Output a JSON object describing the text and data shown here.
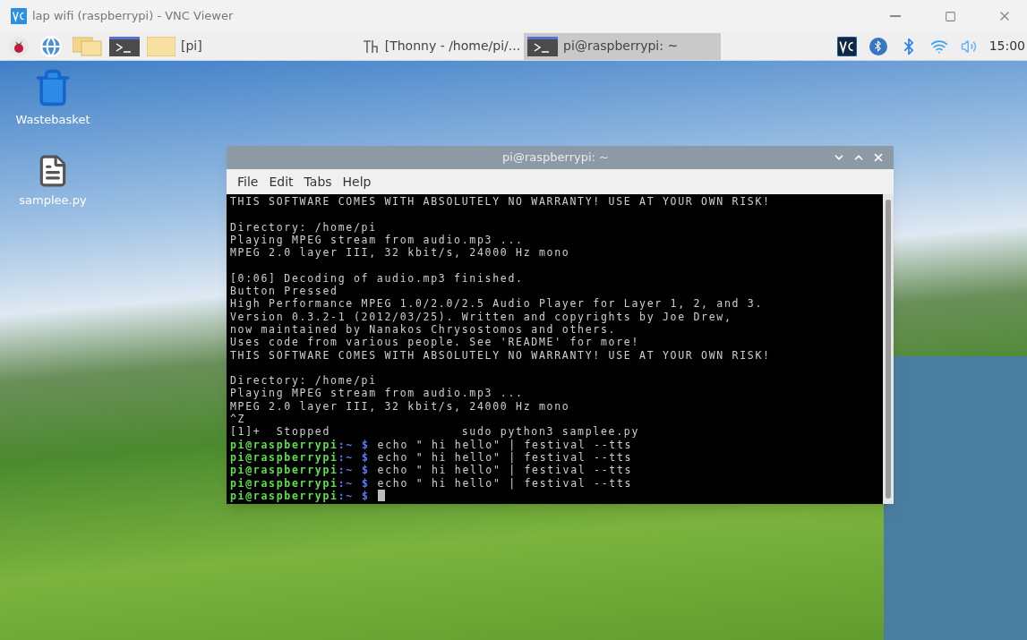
{
  "window": {
    "title": "lap wifi (raspberrypi) - VNC Viewer"
  },
  "taskbar": {
    "launchers": [
      {
        "kind": "raspberry"
      },
      {
        "kind": "globe"
      },
      {
        "kind": "folders"
      },
      {
        "kind": "terminal"
      }
    ],
    "tasks": [
      {
        "kind": "folder",
        "label": "[pi]",
        "selected": false
      },
      {
        "kind": "thonny",
        "label": "[Thonny  -  /home/pi/...",
        "selected": false
      },
      {
        "kind": "terminal",
        "label": "pi@raspberrypi: ~",
        "selected": true
      }
    ],
    "clock": "15:00"
  },
  "desktop_icons": [
    {
      "kind": "trash",
      "label": "Wastebasket"
    },
    {
      "kind": "file",
      "label": "samplee.py"
    }
  ],
  "terminal": {
    "title": "pi@raspberrypi: ~",
    "menu": [
      "File",
      "Edit",
      "Tabs",
      "Help"
    ],
    "lines": [
      {
        "kind": "output",
        "text": "THIS SOFTWARE COMES WITH ABSOLUTELY NO WARRANTY! USE AT YOUR OWN RISK!"
      },
      {
        "kind": "blank"
      },
      {
        "kind": "output",
        "text": "Directory: /home/pi"
      },
      {
        "kind": "output",
        "text": "Playing MPEG stream from audio.mp3 ..."
      },
      {
        "kind": "output",
        "text": "MPEG 2.0 layer III, 32 kbit/s, 24000 Hz mono"
      },
      {
        "kind": "blank"
      },
      {
        "kind": "output",
        "text": "[0:06] Decoding of audio.mp3 finished."
      },
      {
        "kind": "output",
        "text": "Button Pressed"
      },
      {
        "kind": "output",
        "text": "High Performance MPEG 1.0/2.0/2.5 Audio Player for Layer 1, 2, and 3."
      },
      {
        "kind": "output",
        "text": "Version 0.3.2-1 (2012/03/25). Written and copyrights by Joe Drew,"
      },
      {
        "kind": "output",
        "text": "now maintained by Nanakos Chrysostomos and others."
      },
      {
        "kind": "output",
        "text": "Uses code from various people. See 'README' for more!"
      },
      {
        "kind": "output",
        "text": "THIS SOFTWARE COMES WITH ABSOLUTELY NO WARRANTY! USE AT YOUR OWN RISK!"
      },
      {
        "kind": "blank"
      },
      {
        "kind": "output",
        "text": "Directory: /home/pi"
      },
      {
        "kind": "output",
        "text": "Playing MPEG stream from audio.mp3 ..."
      },
      {
        "kind": "output",
        "text": "MPEG 2.0 layer III, 32 kbit/s, 24000 Hz mono"
      },
      {
        "kind": "output",
        "text": "^Z"
      },
      {
        "kind": "output",
        "text": "[1]+  Stopped                 sudo python3 samplee.py"
      },
      {
        "kind": "prompt",
        "user": "pi@raspberrypi",
        "path": ":~",
        "symbol": "$",
        "command": "echo \" hi hello\" | festival --tts",
        "cursor": false
      },
      {
        "kind": "prompt",
        "user": "pi@raspberrypi",
        "path": ":~",
        "symbol": "$",
        "command": "echo \" hi hello\" | festival --tts",
        "cursor": false
      },
      {
        "kind": "prompt",
        "user": "pi@raspberrypi",
        "path": ":~",
        "symbol": "$",
        "command": "echo \" hi hello\" | festival --tts",
        "cursor": false
      },
      {
        "kind": "prompt",
        "user": "pi@raspberrypi",
        "path": ":~",
        "symbol": "$",
        "command": "echo \" hi hello\" | festival --tts",
        "cursor": false
      },
      {
        "kind": "prompt",
        "user": "pi@raspberrypi",
        "path": ":~",
        "symbol": "$",
        "cursor": true
      }
    ]
  }
}
